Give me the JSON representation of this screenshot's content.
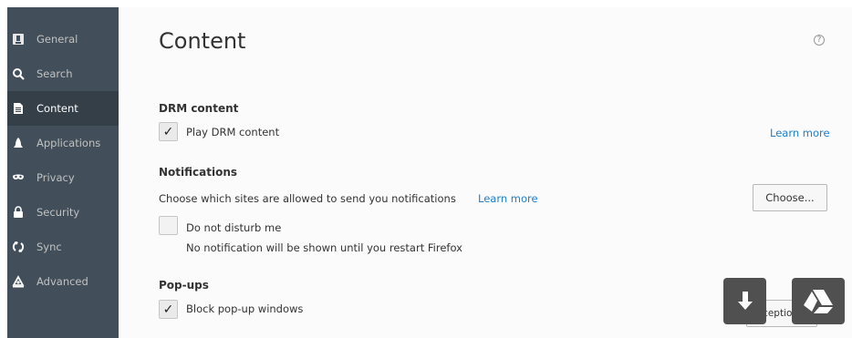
{
  "sidebar": {
    "items": [
      {
        "label": "General",
        "icon": "general-icon"
      },
      {
        "label": "Search",
        "icon": "search-icon"
      },
      {
        "label": "Content",
        "icon": "content-icon",
        "selected": true
      },
      {
        "label": "Applications",
        "icon": "applications-icon"
      },
      {
        "label": "Privacy",
        "icon": "privacy-mask-icon"
      },
      {
        "label": "Security",
        "icon": "lock-icon"
      },
      {
        "label": "Sync",
        "icon": "sync-icon"
      },
      {
        "label": "Advanced",
        "icon": "advanced-icon"
      }
    ]
  },
  "main": {
    "title": "Content",
    "help": "?",
    "drm": {
      "heading": "DRM content",
      "checkbox_label": "Play DRM content",
      "checked": true,
      "learn_more": "Learn more"
    },
    "notifications": {
      "heading": "Notifications",
      "description": "Choose which sites are allowed to send you notifications",
      "learn_more": "Learn more",
      "choose_button": "Choose...",
      "dnd_label": "Do not disturb me",
      "dnd_checked": false,
      "dnd_hint": "No notification will be shown until you restart Firefox"
    },
    "popups": {
      "heading": "Pop-ups",
      "checkbox_label": "Block pop-up windows",
      "checked": true,
      "exceptions_button": "Exceptions..."
    }
  },
  "check_glyph": "✓",
  "colors": {
    "sidebar_bg": "#424f5a",
    "sidebar_selected": "#343f48",
    "link": "#1f7fc4",
    "overlay_button": "#505050"
  }
}
